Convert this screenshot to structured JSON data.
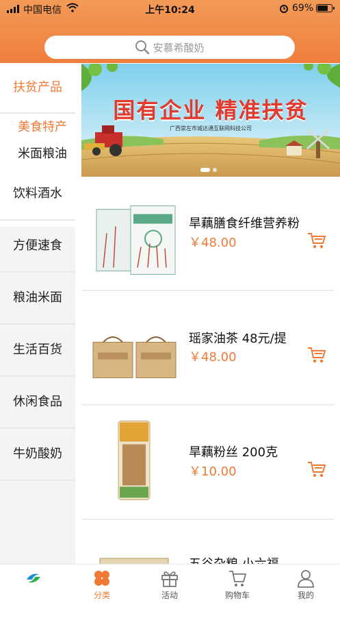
{
  "status_bar": {
    "carrier": "中国电信",
    "time": "上午10:24",
    "battery": "69%"
  },
  "search": {
    "placeholder": "安慕希酸奶",
    "icon": "search-icon"
  },
  "sidebar": {
    "items": [
      {
        "label": "扶贫产品",
        "active": true
      },
      {
        "label": "美食特产",
        "sub": true,
        "active": true
      },
      {
        "label": "米面粮油",
        "sub": true
      },
      {
        "label": "饮料酒水"
      },
      {
        "label": "方便速食"
      },
      {
        "label": "粮油米面"
      },
      {
        "label": "生活百货"
      },
      {
        "label": "休闲食品"
      },
      {
        "label": "牛奶酸奶"
      }
    ]
  },
  "banner": {
    "title": "国有企业 精准扶贫",
    "subtitle": "广西崇左市城达通互联网科技公司"
  },
  "products": [
    {
      "name": "旱藕膳食纤维营养粉",
      "price": "￥48.00"
    },
    {
      "name": "瑶家油茶 48元/提",
      "price": "￥48.00"
    },
    {
      "name": "旱藕粉丝 200克",
      "price": "￥10.00"
    },
    {
      "name": "五谷杂粮 小六福",
      "price": ""
    }
  ],
  "tabbar": {
    "tabs": [
      {
        "label": "",
        "icon": "logo-icon"
      },
      {
        "label": "分类",
        "icon": "category-icon",
        "active": true
      },
      {
        "label": "活动",
        "icon": "gift-icon"
      },
      {
        "label": "购物车",
        "icon": "cart-icon"
      },
      {
        "label": "我的",
        "icon": "user-icon"
      }
    ]
  },
  "colors": {
    "accent": "#ef7a36",
    "header": "#f08a47"
  }
}
